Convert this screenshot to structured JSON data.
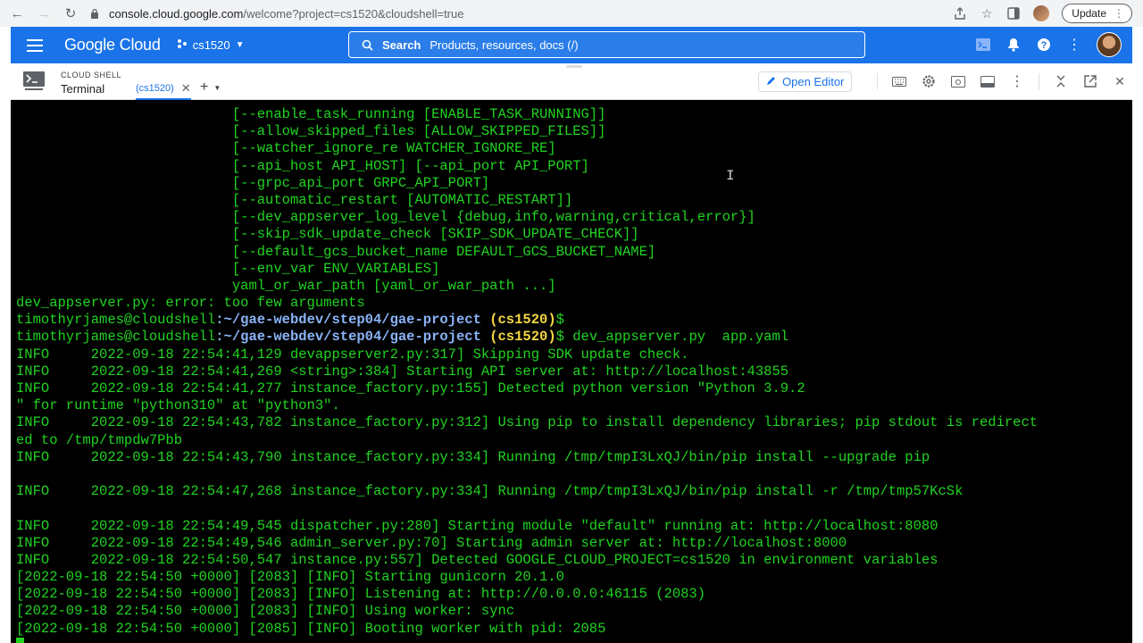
{
  "browser": {
    "url_host": "console.cloud.google.com",
    "url_path": "/welcome?project=cs1520&cloudshell=true",
    "update_label": "Update"
  },
  "console": {
    "logo": "Google Cloud",
    "project": "cs1520",
    "search_label": "Search",
    "search_placeholder": "Products, resources, docs (/)"
  },
  "shell": {
    "title": "CLOUD SHELL",
    "subtitle": "Terminal",
    "tab_label": "(cs1520)",
    "open_editor_label": "Open Editor"
  },
  "terminal": {
    "usage_lines": [
      "                          [--enable_task_running [ENABLE_TASK_RUNNING]]",
      "                          [--allow_skipped_files [ALLOW_SKIPPED_FILES]]",
      "                          [--watcher_ignore_re WATCHER_IGNORE_RE]",
      "                          [--api_host API_HOST] [--api_port API_PORT]",
      "                          [--grpc_api_port GRPC_API_PORT]",
      "                          [--automatic_restart [AUTOMATIC_RESTART]]",
      "                          [--dev_appserver_log_level {debug,info,warning,critical,error}]",
      "                          [--skip_sdk_update_check [SKIP_SDK_UPDATE_CHECK]]",
      "                          [--default_gcs_bucket_name DEFAULT_GCS_BUCKET_NAME]",
      "                          [--env_var ENV_VARIABLES]",
      "                          yaml_or_war_path [yaml_or_war_path ...]",
      "dev_appserver.py: error: too few arguments"
    ],
    "prompt_user": "timothyrjames@cloudshell",
    "prompt_path": ":~/gae-webdev/step04/gae-project",
    "prompt_project": " (cs1520)",
    "prompt_symbol": "$",
    "command": " dev_appserver.py  app.yaml",
    "output_lines": [
      "INFO     2022-09-18 22:54:41,129 devappserver2.py:317] Skipping SDK update check.",
      "INFO     2022-09-18 22:54:41,269 <string>:384] Starting API server at: http://localhost:43855",
      "INFO     2022-09-18 22:54:41,277 instance_factory.py:155] Detected python version \"Python 3.9.2",
      "\" for runtime \"python310\" at \"python3\".",
      "INFO     2022-09-18 22:54:43,782 instance_factory.py:312] Using pip to install dependency libraries; pip stdout is redirect",
      "ed to /tmp/tmpdw7Pbb",
      "INFO     2022-09-18 22:54:43,790 instance_factory.py:334] Running /tmp/tmpI3LxQJ/bin/pip install --upgrade pip",
      "",
      "INFO     2022-09-18 22:54:47,268 instance_factory.py:334] Running /tmp/tmpI3LxQJ/bin/pip install -r /tmp/tmp57KcSk",
      "",
      "INFO     2022-09-18 22:54:49,545 dispatcher.py:280] Starting module \"default\" running at: http://localhost:8080",
      "INFO     2022-09-18 22:54:49,546 admin_server.py:70] Starting admin server at: http://localhost:8000",
      "INFO     2022-09-18 22:54:50,547 instance.py:557] Detected GOOGLE_CLOUD_PROJECT=cs1520 in environment variables",
      "[2022-09-18 22:54:50 +0000] [2083] [INFO] Starting gunicorn 20.1.0",
      "[2022-09-18 22:54:50 +0000] [2083] [INFO] Listening at: http://0.0.0.0:46115 (2083)",
      "[2022-09-18 22:54:50 +0000] [2083] [INFO] Using worker: sync",
      "[2022-09-18 22:54:50 +0000] [2085] [INFO] Booting worker with pid: 2085"
    ]
  }
}
